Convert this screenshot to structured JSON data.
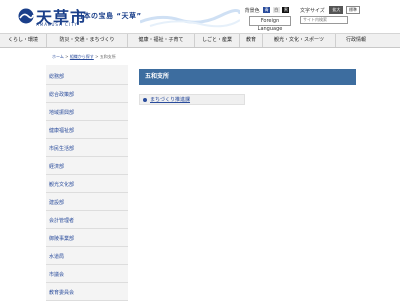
{
  "header": {
    "logo_name": "天草市",
    "logo_sub": "AMAKUSA CITY",
    "tagline": "日本の宝島 “天草”",
    "bg_color_label": "背景色",
    "bg_colors": [
      "青",
      "白",
      "黒"
    ],
    "font_size_label": "文字サイズ",
    "font_sizes": [
      "拡大",
      "標準"
    ],
    "lang_button": "Foreign Language",
    "search_placeholder": "サイト内検索"
  },
  "nav": {
    "items": [
      "くらし・環境",
      "防災・交通・まちづくり",
      "健康・福祉・子育て",
      "しごと・産業",
      "教育",
      "観光・文化・スポーツ",
      "行政情報"
    ]
  },
  "breadcrumb": {
    "home": "ホーム",
    "sep": ">",
    "parent": "組織から探す",
    "current": "五和支所"
  },
  "sidebar": {
    "items": [
      "総務部",
      "総合政策部",
      "地域振興部",
      "健康福祉部",
      "市民生活部",
      "経済部",
      "観光文化部",
      "建設部",
      "会計管理者",
      "御陵事業部",
      "水道局",
      "市議会",
      "教育委員会"
    ]
  },
  "main": {
    "title": "五和支所",
    "links": [
      "まちづくり推進課"
    ]
  },
  "colors": {
    "accent": "#3d6d9f",
    "link": "#2a4c9c",
    "nav_bg": "#f0f0f0"
  }
}
